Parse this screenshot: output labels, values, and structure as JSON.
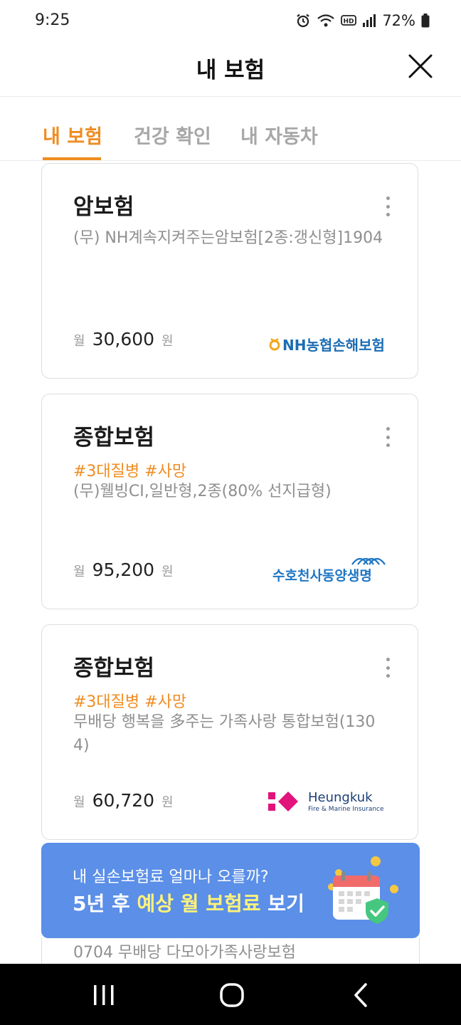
{
  "status_bar": {
    "time": "9:25",
    "battery": "72%",
    "icons": [
      "alarm-icon",
      "wifi-icon",
      "hd-voice-icon",
      "signal-icon",
      "battery-icon"
    ]
  },
  "header": {
    "title": "내 보험",
    "close_icon": "close-icon"
  },
  "tabs": [
    {
      "label": "내 보험",
      "active": true
    },
    {
      "label": "건강 확인",
      "active": false
    },
    {
      "label": "내 자동차",
      "active": false
    }
  ],
  "cards": [
    {
      "title": "암보험",
      "tags": "",
      "product": "(무) NH계속지켜주는암보험[2종:갱신형]1904",
      "price_prefix": "월",
      "price": "30,600",
      "price_suffix": "원",
      "insurer": "NH농협손해보험"
    },
    {
      "title": "종합보험",
      "tags": "#3대질병 #사망",
      "product": "(무)웰빙CI,일반형,2종(80% 선지급형)",
      "price_prefix": "월",
      "price": "95,200",
      "price_suffix": "원",
      "insurer": "수호천사동양생명"
    },
    {
      "title": "종합보험",
      "tags": "#3대질병 #사망",
      "product": "무배당 행복을 多주는 가족사랑 통합보험(1304)",
      "price_prefix": "월",
      "price": "60,720",
      "price_suffix": "원",
      "insurer": "Heungkuk",
      "insurer_sub": "Fire & Marine Insurance"
    }
  ],
  "banner": {
    "line1": "내 실손보험료 얼마나 오를까?",
    "line2_pre": "5년 후 ",
    "line2_highlight": "예상 월 보험료",
    "line2_post": " 보기"
  },
  "partial_card": {
    "product": "0704 무배당 다모아가족사랑보험"
  },
  "colors": {
    "accent": "#ef8d22",
    "banner": "#5b8fe8",
    "banner_highlight": "#fff27a",
    "nh_blue": "#1c6db3",
    "dongyang_blue": "#1f76c3",
    "heungkuk_pink": "#e2137b"
  },
  "navbar": {
    "icons": [
      "recent-apps-icon",
      "home-icon",
      "back-icon"
    ]
  }
}
